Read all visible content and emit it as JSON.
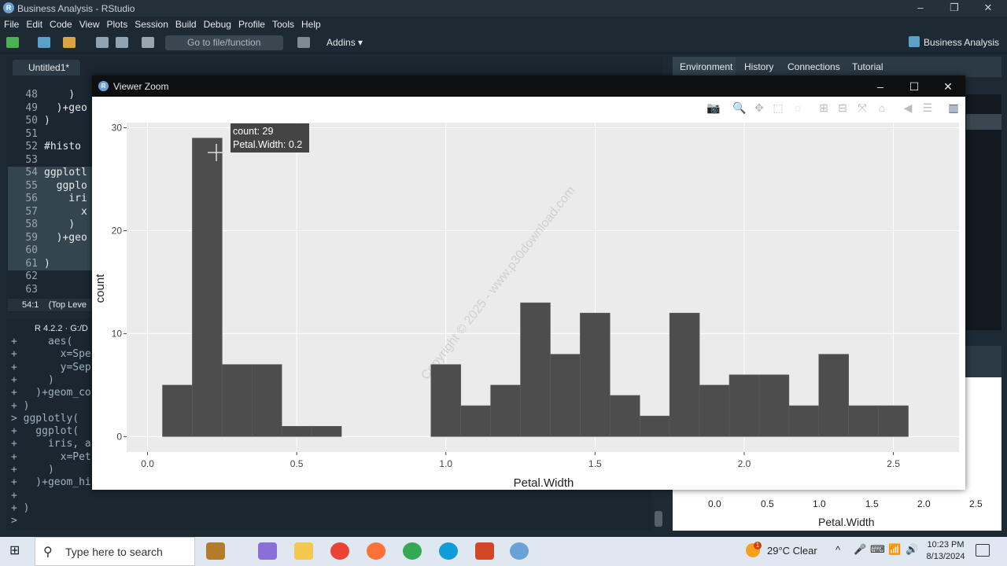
{
  "window": {
    "title": "Business Analysis - RStudio",
    "app_badge": "R",
    "controls": [
      "–",
      "❐",
      "✕"
    ]
  },
  "menu": [
    "File",
    "Edit",
    "Code",
    "View",
    "Plots",
    "Session",
    "Build",
    "Debug",
    "Profile",
    "Tools",
    "Help"
  ],
  "toolbar": {
    "goto_placeholder": "Go to file/function",
    "addins_label": "Addins",
    "project_label": "Business Analysis"
  },
  "editor": {
    "tab_label": "Untitled1*",
    "lines": [
      {
        "n": "48",
        "t": "    )"
      },
      {
        "n": "49",
        "t": "  )+geo"
      },
      {
        "n": "50",
        "t": ")"
      },
      {
        "n": "51",
        "t": ""
      },
      {
        "n": "52",
        "t": "#histo"
      },
      {
        "n": "53",
        "t": ""
      },
      {
        "n": "54",
        "t": "ggplotl"
      },
      {
        "n": "55",
        "t": "  ggplo"
      },
      {
        "n": "56",
        "t": "    iri"
      },
      {
        "n": "57",
        "t": "      x"
      },
      {
        "n": "58",
        "t": "    )"
      },
      {
        "n": "59",
        "t": "  )+geo"
      },
      {
        "n": "60",
        "t": ""
      },
      {
        "n": "61",
        "t": ")"
      },
      {
        "n": "62",
        "t": ""
      },
      {
        "n": "63",
        "t": ""
      }
    ],
    "status_pos": "54:1",
    "status_scope": "(Top Leve"
  },
  "console": {
    "header": "R 4.2.2 · G:/D",
    "lines": [
      "+     aes(",
      "+       x=Spe",
      "+       y=Sep",
      "+     )",
      "+   )+geom_co",
      "+ )",
      "> ggplotly(",
      "+   ggplot(",
      "+     iris, a",
      "+       x=Pet",
      "+     )",
      "+   )+geom_hi",
      "+",
      "+ )",
      ">"
    ]
  },
  "right_panel": {
    "tabs": [
      "Environment",
      "History",
      "Connections",
      "Tutorial"
    ],
    "active_tab": "Environment",
    "mini_plot_xlabel": "Petal.Width",
    "mini_ticks": [
      "0.0",
      "0.5",
      "1.0",
      "1.5",
      "2.0",
      "2.5"
    ]
  },
  "viewer": {
    "title": "Viewer Zoom",
    "badge": "R",
    "controls": [
      "–",
      "☐",
      "✕"
    ],
    "modebar_icons": [
      "camera-icon",
      "zoom-icon",
      "pan-icon",
      "box-select-icon",
      "lasso-icon",
      "zoom-in-icon",
      "zoom-out-icon",
      "autoscale-icon",
      "reset-axes-icon",
      "spike-lines-icon",
      "compare-hover-icon",
      "plotly-logo-icon"
    ],
    "tooltip": {
      "line1": "count: 29",
      "line2": "Petal.Width: 0.2"
    },
    "watermark": "Copyright © 2025 - www.p30download.com"
  },
  "chart_data": {
    "type": "bar",
    "xlabel": "Petal.Width",
    "ylabel": "count",
    "xlim": [
      -0.07,
      2.72
    ],
    "ylim": [
      -1.5,
      30.5
    ],
    "xticks": [
      0.0,
      0.5,
      1.0,
      1.5,
      2.0,
      2.5
    ],
    "xtick_labels": [
      "0.0",
      "0.5",
      "1.0",
      "1.5",
      "2.0",
      "2.5"
    ],
    "yticks": [
      0,
      10,
      20,
      30
    ],
    "ytick_labels": [
      "0",
      "10",
      "20",
      "30"
    ],
    "bin_width": 0.1,
    "bins": [
      {
        "center": 0.1,
        "count": 5
      },
      {
        "center": 0.2,
        "count": 29
      },
      {
        "center": 0.3,
        "count": 7
      },
      {
        "center": 0.4,
        "count": 7
      },
      {
        "center": 0.5,
        "count": 1
      },
      {
        "center": 0.6,
        "count": 1
      },
      {
        "center": 1.0,
        "count": 7
      },
      {
        "center": 1.1,
        "count": 3
      },
      {
        "center": 1.2,
        "count": 5
      },
      {
        "center": 1.3,
        "count": 13
      },
      {
        "center": 1.4,
        "count": 8
      },
      {
        "center": 1.5,
        "count": 12
      },
      {
        "center": 1.6,
        "count": 4
      },
      {
        "center": 1.7,
        "count": 2
      },
      {
        "center": 1.8,
        "count": 12
      },
      {
        "center": 1.9,
        "count": 5
      },
      {
        "center": 2.0,
        "count": 6
      },
      {
        "center": 2.1,
        "count": 6
      },
      {
        "center": 2.2,
        "count": 3
      },
      {
        "center": 2.3,
        "count": 8
      },
      {
        "center": 2.4,
        "count": 3
      },
      {
        "center": 2.5,
        "count": 3
      }
    ],
    "bar_color": "#4d4d4d",
    "panel_bg": "#ebebeb",
    "grid": true
  },
  "taskbar": {
    "search_placeholder": "Type here to search",
    "weather": "29°C  Clear",
    "time": "10:23 PM",
    "date": "8/13/2024",
    "weather_badge": "1"
  }
}
